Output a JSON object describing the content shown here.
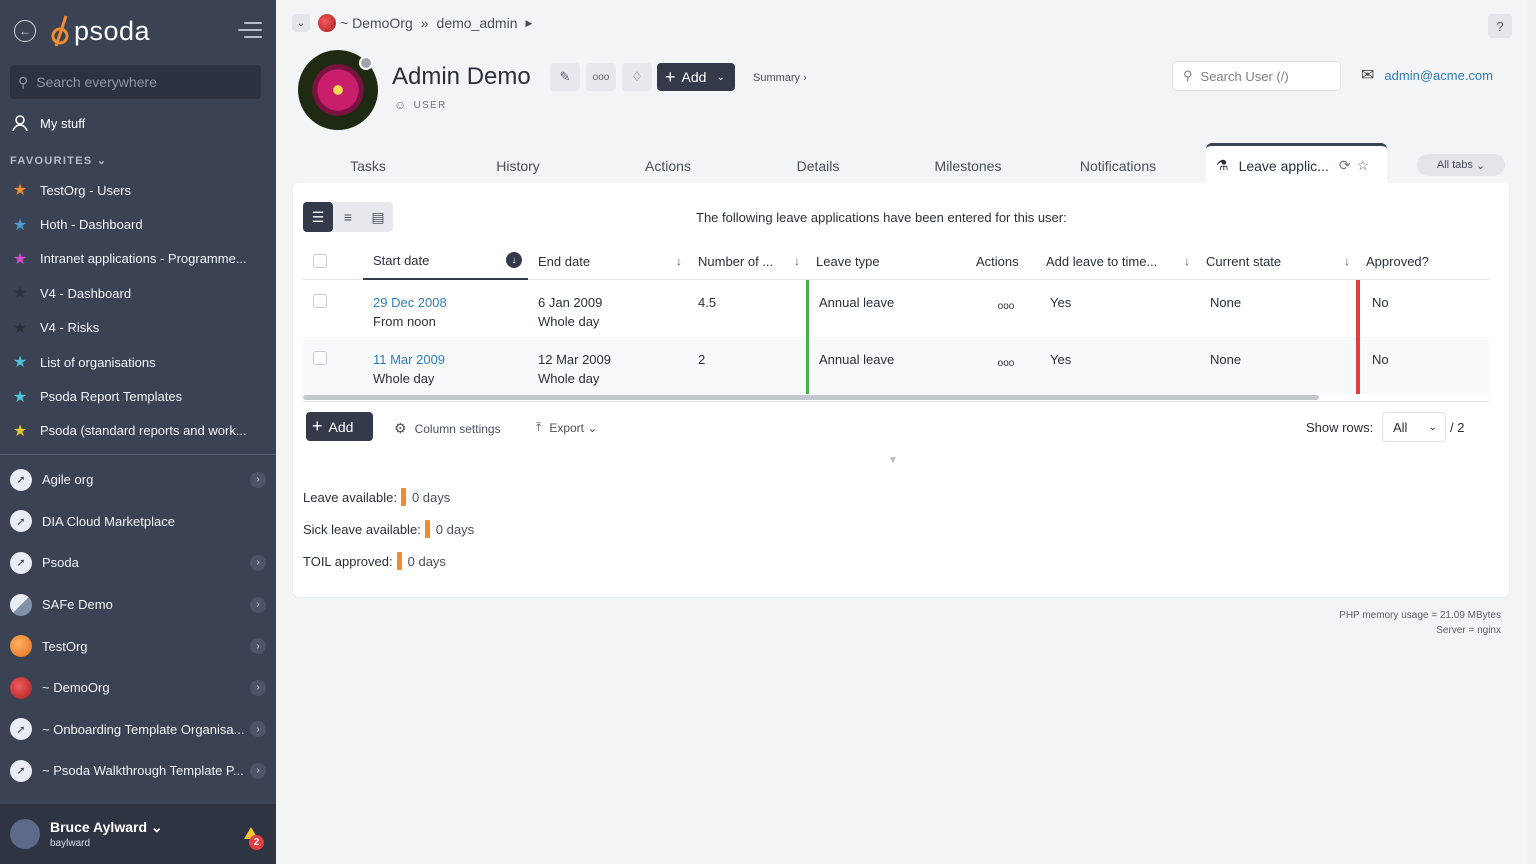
{
  "sidebar": {
    "logo_text": "psoda",
    "search_placeholder": "Search everywhere",
    "my_stuff": "My stuff",
    "favourites_heading": "FAVOURITES",
    "favourites": [
      {
        "label": "TestOrg - Users",
        "color": "#f28b30"
      },
      {
        "label": "Hoth - Dashboard",
        "color": "#4d9bd9"
      },
      {
        "label": "Intranet applications - Programme...",
        "color": "#d64bd0"
      },
      {
        "label": "V4 - Dashboard",
        "color": "#2b2f3a"
      },
      {
        "label": "V4 - Risks",
        "color": "#2b2f3a"
      },
      {
        "label": "List of organisations",
        "color": "#4dc4d6"
      },
      {
        "label": "Psoda Report Templates",
        "color": "#4dc4d6"
      },
      {
        "label": "Psoda (standard reports and work...",
        "color": "#e8c63a"
      }
    ],
    "orgs": [
      {
        "label": "Agile org",
        "has_children": true
      },
      {
        "label": "DIA Cloud Marketplace",
        "has_children": false
      },
      {
        "label": "Psoda",
        "has_children": true
      },
      {
        "label": "SAFe Demo",
        "has_children": true
      },
      {
        "label": "TestOrg",
        "has_children": true
      },
      {
        "label": "~ DemoOrg",
        "has_children": true
      },
      {
        "label": "~ Onboarding Template Organisa...",
        "has_children": true
      },
      {
        "label": "~ Psoda Walkthrough Template P...",
        "has_children": true
      }
    ],
    "user": {
      "name": "Bruce Aylward",
      "login": "baylward",
      "notifications": "2"
    }
  },
  "breadcrumb": {
    "org": "~ DemoOrg",
    "separator": "»",
    "current": "demo_admin"
  },
  "help_label": "?",
  "profile": {
    "name": "Admin Demo",
    "role": "USER",
    "add_label": "Add",
    "summary_label": "Summary ›"
  },
  "search_user_placeholder": "Search User (/)",
  "email": "admin@acme.com",
  "tabs": [
    "Tasks",
    "History",
    "Actions",
    "Details",
    "Milestones",
    "Notifications"
  ],
  "active_tab": "Leave applic...",
  "all_tabs_label": "All tabs",
  "panel": {
    "intro": "The following leave applications have been entered for this user:",
    "columns": [
      "Start date",
      "End date",
      "Number of ...",
      "Leave type",
      "Actions",
      "Add leave to time...",
      "Current state",
      "Approved?"
    ],
    "rows": [
      {
        "start": "29 Dec 2008",
        "start_sub": "From noon",
        "end": "6 Jan 2009",
        "end_sub": "Whole day",
        "number": "4.5",
        "type": "Annual leave",
        "actions": "ooo",
        "add_leave": "Yes",
        "state": "None",
        "approved": "No"
      },
      {
        "start": "11 Mar 2009",
        "start_sub": "Whole day",
        "end": "12 Mar 2009",
        "end_sub": "Whole day",
        "number": "2",
        "type": "Annual leave",
        "actions": "ooo",
        "add_leave": "Yes",
        "state": "None",
        "approved": "No"
      }
    ],
    "add_label": "Add",
    "column_settings_label": "Column settings",
    "export_label": "Export",
    "show_rows_label": "Show rows:",
    "show_rows_value": "All",
    "rows_total": "/ 2",
    "stats": [
      {
        "label": "Leave available:",
        "value": "0 days"
      },
      {
        "label": "Sick leave available:",
        "value": "0 days"
      },
      {
        "label": "TOIL approved:",
        "value": "0 days"
      }
    ]
  },
  "footer": {
    "memory": "PHP memory usage = 21.09 MBytes",
    "server": "Server = nginx"
  }
}
